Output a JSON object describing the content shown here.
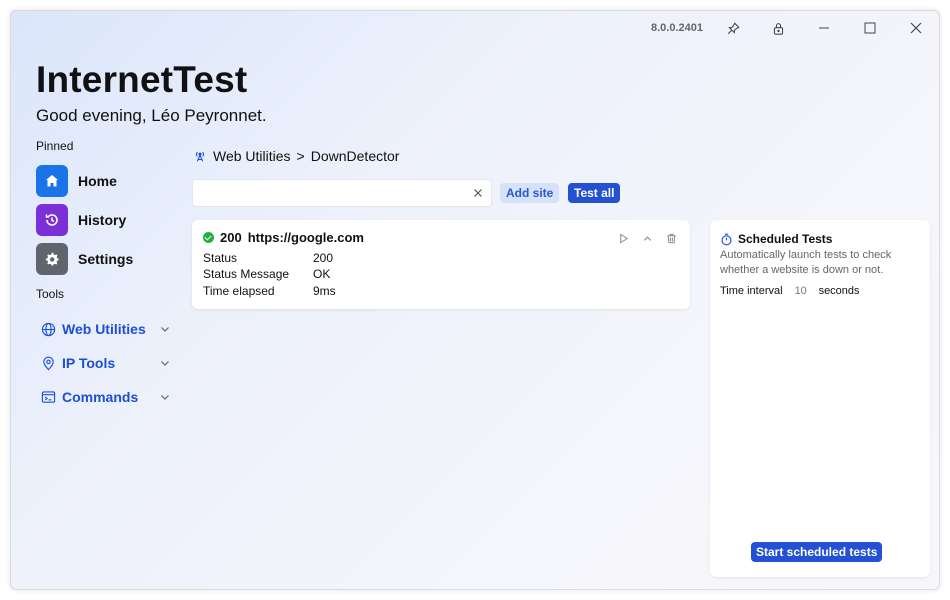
{
  "window": {
    "version": "8.0.0.2401",
    "controls": [
      "pin-icon",
      "lock-icon",
      "minimize-icon",
      "maximize-icon",
      "close-icon"
    ]
  },
  "header": {
    "title": "InternetTest",
    "greeting": "Good evening, Léo Peyronnet."
  },
  "sidebar": {
    "pinned_label": "Pinned",
    "pinned": [
      {
        "label": "Home",
        "icon": "home-icon",
        "color": "#1a73e8"
      },
      {
        "label": "History",
        "icon": "history-icon",
        "color": "#7b2fd6"
      },
      {
        "label": "Settings",
        "icon": "gear-icon",
        "color": "#60646c"
      }
    ],
    "tools_label": "Tools",
    "tools": [
      {
        "label": "Web Utilities",
        "icon": "globe-icon"
      },
      {
        "label": "IP Tools",
        "icon": "location-pin-icon"
      },
      {
        "label": "Commands",
        "icon": "terminal-icon"
      }
    ]
  },
  "breadcrumb": {
    "section": "Web Utilities",
    "separator": ">",
    "page": "DownDetector"
  },
  "controls": {
    "site_input_value": "",
    "site_input_placeholder": "",
    "add_site": "Add site",
    "test_all": "Test all"
  },
  "result": {
    "code": "200",
    "url": "https://google.com",
    "status_color": "#22b140",
    "rows": [
      {
        "key": "Status",
        "value": "200"
      },
      {
        "key": "Status Message",
        "value": "OK"
      },
      {
        "key": "Time elapsed",
        "value": "9ms"
      }
    ]
  },
  "scheduled": {
    "title": "Scheduled Tests",
    "description": "Automatically launch tests to check whether a website is down or not.",
    "interval_label": "Time interval",
    "interval_value": "10",
    "interval_unit": "seconds",
    "start_button": "Start scheduled tests"
  },
  "colors": {
    "accent": "#2351d3",
    "accent_light": "#d6e2fb",
    "link": "#1d4ed8"
  }
}
